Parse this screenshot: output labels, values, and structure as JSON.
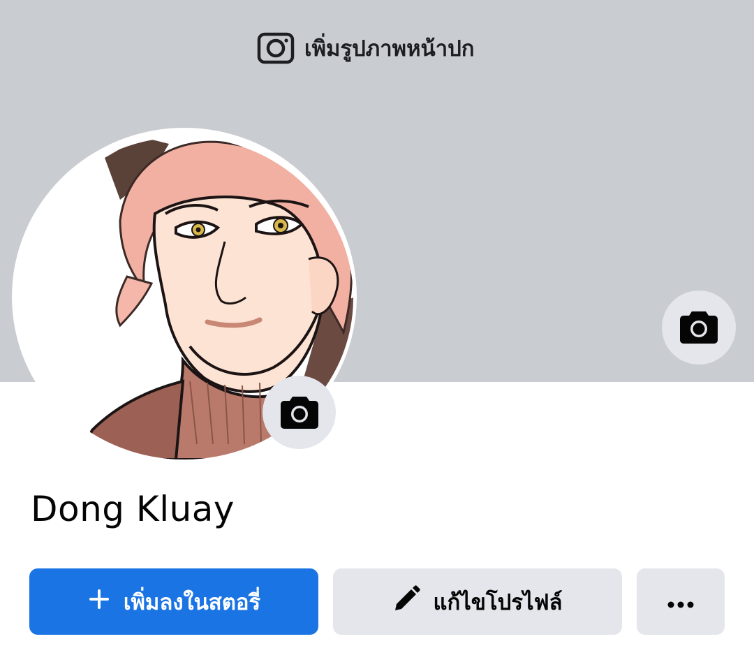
{
  "cover": {
    "add_cover_label": "เพิ่มรูปภาพหน้าปก",
    "add_cover_icon": "camera-outline-icon",
    "edit_cover_icon": "camera-icon",
    "background_color": "#c9ccd1"
  },
  "profile": {
    "name": "Dong Kluay",
    "avatar": "illustrated-portrait",
    "edit_avatar_icon": "camera-icon"
  },
  "actions": {
    "add_story_label": "เพิ่มลงในสตอรี่",
    "add_story_icon": "plus-icon",
    "edit_profile_label": "แก้ไขโปรไฟล์",
    "edit_profile_icon": "pencil-icon",
    "more_icon": "more-dots-icon"
  },
  "colors": {
    "primary": "#1b74e4",
    "secondary_button": "#e4e6eb",
    "text": "#050505"
  }
}
